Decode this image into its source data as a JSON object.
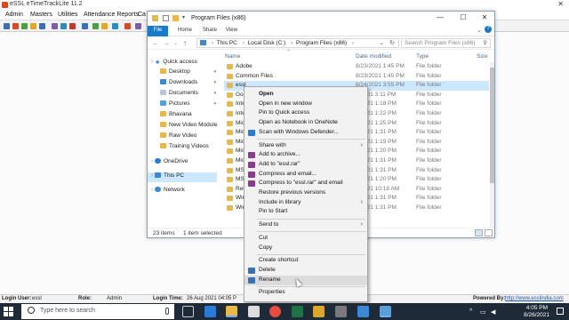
{
  "app": {
    "title": "eSSL eTimeTrackLite 11.2",
    "menu": [
      "Admin",
      "Masters",
      "Utilities",
      "Attendance Reports",
      "Ca"
    ],
    "status": {
      "login_user_label": "Login User:",
      "login_user": "essl",
      "role_label": "Role:",
      "role": "Admin",
      "login_time_label": "Login Time:",
      "login_time": "26 Aug 2021 04:05 P",
      "powered_by_label": "Powered By:",
      "powered_by_link": "http://www.esslindia.com"
    }
  },
  "explorer": {
    "title": "Program Files (x86)",
    "ribbon_tabs": [
      "File",
      "Home",
      "Share",
      "View"
    ],
    "address": [
      "This PC",
      "Local Disk (C:)",
      "Program Files (x86)"
    ],
    "search_placeholder": "Search Program Files (x86)",
    "columns": {
      "name": "Name",
      "date": "Date modified",
      "type": "Type",
      "size": "Size"
    },
    "nav": [
      {
        "label": "Quick access",
        "icon": "star-icon"
      },
      {
        "label": "Desktop",
        "icon": "folder-icon",
        "pinned": true
      },
      {
        "label": "Downloads",
        "icon": "folder-icon",
        "pinned": true
      },
      {
        "label": "Documents",
        "icon": "folder-icon",
        "pinned": true
      },
      {
        "label": "Pictures",
        "icon": "folder-icon",
        "pinned": true
      },
      {
        "label": "Bhavana",
        "icon": "folder-icon"
      },
      {
        "label": "New Video Module",
        "icon": "folder-icon"
      },
      {
        "label": "Raw Video",
        "icon": "folder-icon"
      },
      {
        "label": "Training Videos",
        "icon": "folder-icon"
      },
      {
        "label": "OneDrive",
        "icon": "cloud-icon"
      },
      {
        "label": "This PC",
        "icon": "pc-icon",
        "selected": true
      },
      {
        "label": "Network",
        "icon": "network-icon"
      }
    ],
    "files": [
      {
        "name": "Adobe",
        "date": "8/23/2021 1:45 PM",
        "type": "File folder"
      },
      {
        "name": "Common Files",
        "date": "8/23/2021 1:45 PM",
        "type": "File folder"
      },
      {
        "name": "essl",
        "date": "8/24/2021 3:55 PM",
        "type": "File folder",
        "selected": true
      },
      {
        "name": "Goo",
        "date": "3/2021 3:11 PM",
        "type": "File folder"
      },
      {
        "name": "Inte",
        "date": "3/2021 1:18 PM",
        "type": "File folder"
      },
      {
        "name": "Inte",
        "date": "3/2021 1:22 PM",
        "type": "File folder"
      },
      {
        "name": "Mic",
        "date": "3/2021 1:25 PM",
        "type": "File folder"
      },
      {
        "name": "Mic",
        "date": "3/2021 1:31 PM",
        "type": "File folder"
      },
      {
        "name": "Mic",
        "date": "3/2021 1:19 PM",
        "type": "File folder"
      },
      {
        "name": "Mic",
        "date": "3/2021 1:20 PM",
        "type": "File folder"
      },
      {
        "name": "Mic",
        "date": "3/2021 1:31 PM",
        "type": "File folder"
      },
      {
        "name": "MSE",
        "date": "3/2021 1:31 PM",
        "type": "File folder"
      },
      {
        "name": "MSE",
        "date": "3/2021 1:20 PM",
        "type": "File folder"
      },
      {
        "name": "Refe",
        "date": "3/2021 10:18 AM",
        "type": "File folder"
      },
      {
        "name": "Win",
        "date": "3/2021 1:31 PM",
        "type": "File folder"
      },
      {
        "name": "Win",
        "date": "3/2021 1:31 PM",
        "type": "File folder"
      }
    ],
    "status_count": "23 items",
    "status_selected": "1 item selected"
  },
  "context_menu": {
    "items": [
      {
        "label": "Open",
        "bold": true
      },
      {
        "label": "Open in new window"
      },
      {
        "label": "Pin to Quick access"
      },
      {
        "label": "Open as Notebook in OneNote"
      },
      {
        "label": "Scan with Windows Defender...",
        "icon": "defender-icon"
      },
      {
        "sep": true
      },
      {
        "label": "Share with",
        "submenu": true
      },
      {
        "label": "Add to archive...",
        "icon": "archive-icon"
      },
      {
        "label": "Add to \"essl.rar\"",
        "icon": "archive-icon"
      },
      {
        "label": "Compress and email...",
        "icon": "archive-icon"
      },
      {
        "label": "Compress to \"essl.rar\" and email",
        "icon": "archive-icon"
      },
      {
        "label": "Restore previous versions"
      },
      {
        "label": "Include in library",
        "submenu": true
      },
      {
        "label": "Pin to Start"
      },
      {
        "sep": true
      },
      {
        "label": "Send to",
        "submenu": true
      },
      {
        "sep": true
      },
      {
        "label": "Cut"
      },
      {
        "label": "Copy"
      },
      {
        "sep": true
      },
      {
        "label": "Create shortcut"
      },
      {
        "label": "Delete",
        "icon": "shield-icon"
      },
      {
        "label": "Rename",
        "icon": "shield-icon",
        "hover": true
      },
      {
        "sep": true
      },
      {
        "label": "Properties"
      }
    ]
  },
  "taskbar": {
    "search_placeholder": "Type here to search",
    "time": "4:05 PM",
    "date": "8/26/2021"
  }
}
